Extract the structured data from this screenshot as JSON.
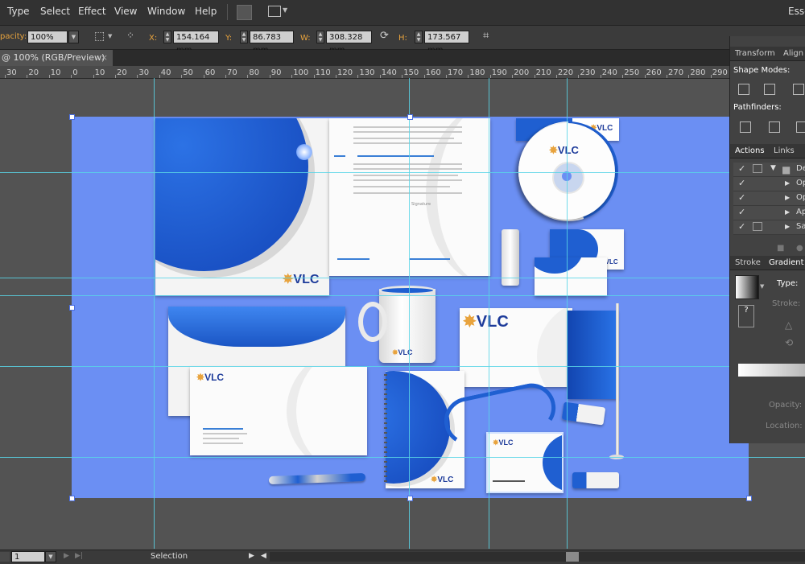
{
  "menubar": {
    "items": [
      "Type",
      "Select",
      "Effect",
      "View",
      "Window",
      "Help"
    ],
    "workspace": "Esse"
  },
  "control": {
    "opacity_label": "pacity:",
    "opacity_value": "100%",
    "x_label": "X:",
    "x_value": "154.164 mm",
    "y_label": "Y:",
    "y_value": "86.783 mm",
    "w_label": "W:",
    "w_value": "308.328 mm",
    "h_label": "H:",
    "h_value": "173.567 mm"
  },
  "document": {
    "tab_title": "@ 100% (RGB/Preview)"
  },
  "ruler": {
    "labels": [
      "30",
      "20",
      "10",
      "0",
      "10",
      "20",
      "30",
      "40",
      "50",
      "60",
      "70",
      "80",
      "90",
      "100",
      "110",
      "120",
      "130",
      "140",
      "150",
      "160",
      "170",
      "180",
      "190",
      "200",
      "210",
      "220",
      "230",
      "240",
      "250",
      "260",
      "270",
      "280",
      "290"
    ]
  },
  "artboard": {
    "logo_text": "VLC",
    "signature": "Signature"
  },
  "panels": {
    "transform_tab": "Transform",
    "align_tab": "Align",
    "shape_modes": "Shape Modes:",
    "pathfinders": "Pathfinders:",
    "actions_tab": "Actions",
    "links_tab": "Links",
    "action_rows": [
      "De",
      "Op",
      "Op",
      "Ap",
      "Sa"
    ],
    "stroke_tab": "Stroke",
    "gradient_tab": "Gradient",
    "type_label": "Type:",
    "stroke_label": "Stroke:",
    "opacity_label": "Opacity:",
    "location_label": "Location:"
  },
  "status": {
    "page": "1",
    "tool": "Selection"
  },
  "colors": {
    "artboard": "#6b8ff3",
    "guides": "#59d5e6",
    "brand_blue": "#1f5fd1"
  }
}
